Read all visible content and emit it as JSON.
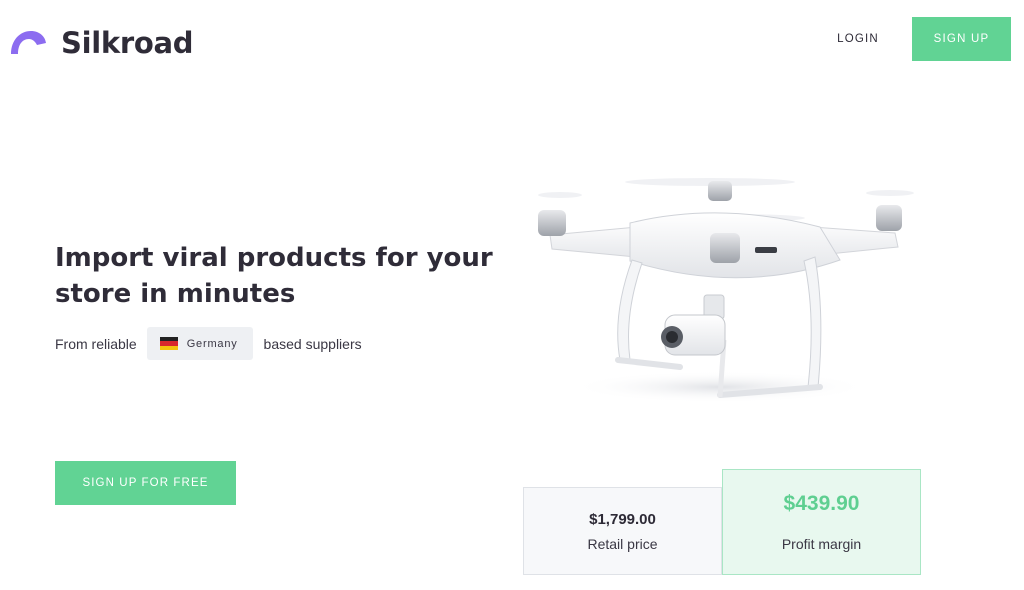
{
  "brand": {
    "name": "Silkroad",
    "logo_color": "#8c6cf0"
  },
  "nav": {
    "login_label": "LOGIN",
    "signup_label": "SIGN UP"
  },
  "hero": {
    "headline_line1": "Import viral products for your",
    "headline_line2": "store in minutes",
    "sub_prefix": "From reliable",
    "country": "Germany",
    "country_flag_icon": "germany-flag-icon",
    "sub_suffix": "based suppliers",
    "cta_label": "SIGN UP FOR FREE"
  },
  "product": {
    "image_icon": "drone-image",
    "retail_price": "$1,799.00",
    "retail_label": "Retail price",
    "profit_margin": "$439.90",
    "profit_label": "Profit margin"
  },
  "colors": {
    "accent": "#61d394",
    "text": "#2d2a36",
    "margin_bg": "#e8f8ef"
  }
}
